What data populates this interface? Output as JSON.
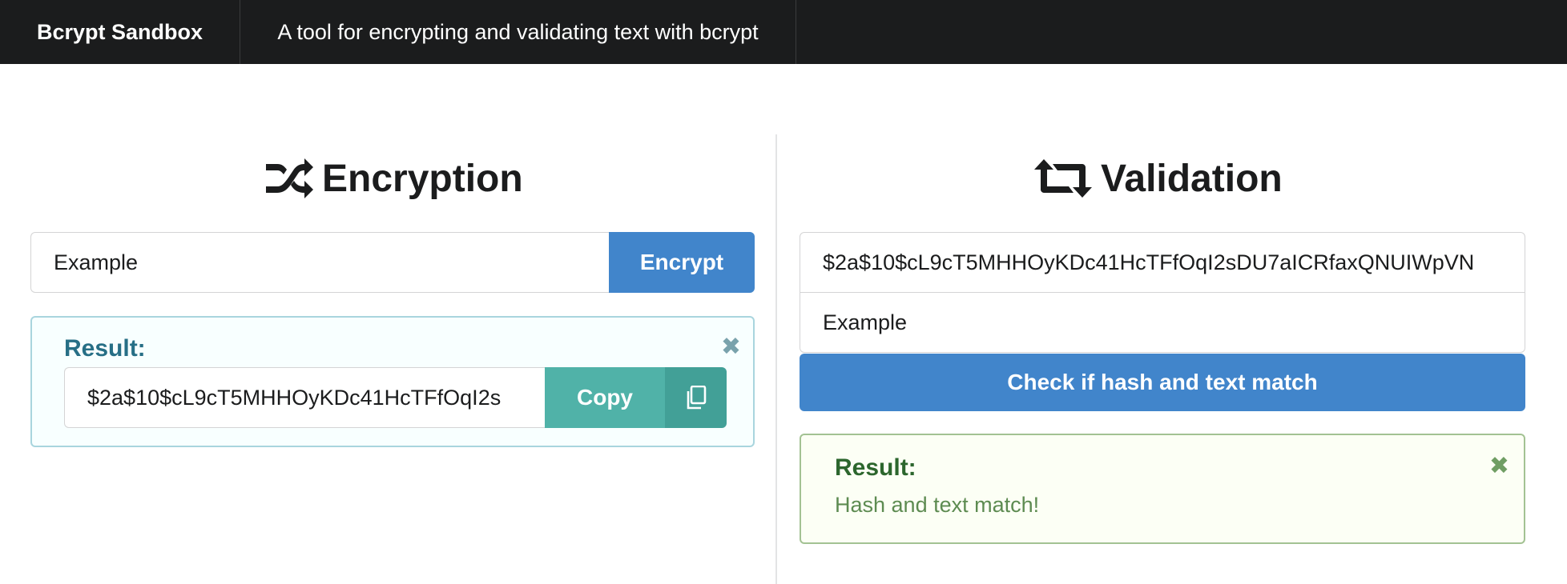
{
  "topbar": {
    "brand": "Bcrypt Sandbox",
    "tagline": "A tool for encrypting and validating text with bcrypt"
  },
  "encryption": {
    "title": "Encryption",
    "icon": "shuffle-icon",
    "input_value": "Example",
    "button_label": "Encrypt",
    "result": {
      "label": "Result:",
      "hash_value": "$2a$10$cL9cT5MHHOyKDc41HcTFfOqI2s",
      "copy_label": "Copy",
      "copy_icon": "copy-icon",
      "close_icon": "close-icon"
    }
  },
  "validation": {
    "title": "Validation",
    "icon": "retweet-icon",
    "hash_value": "$2a$10$cL9cT5MHHOyKDc41HcTFfOqI2sDU7aICRfaxQNUIWpVN",
    "text_value": "Example",
    "button_label": "Check if hash and text match",
    "result": {
      "label": "Result:",
      "message": "Hash and text match!",
      "close_icon": "close-icon"
    }
  },
  "colors": {
    "topbar": "#1b1c1d",
    "primary": "#4185cb",
    "teal": "#50b2a8",
    "info_border": "#a9d5de",
    "success_border": "#a3c293"
  }
}
